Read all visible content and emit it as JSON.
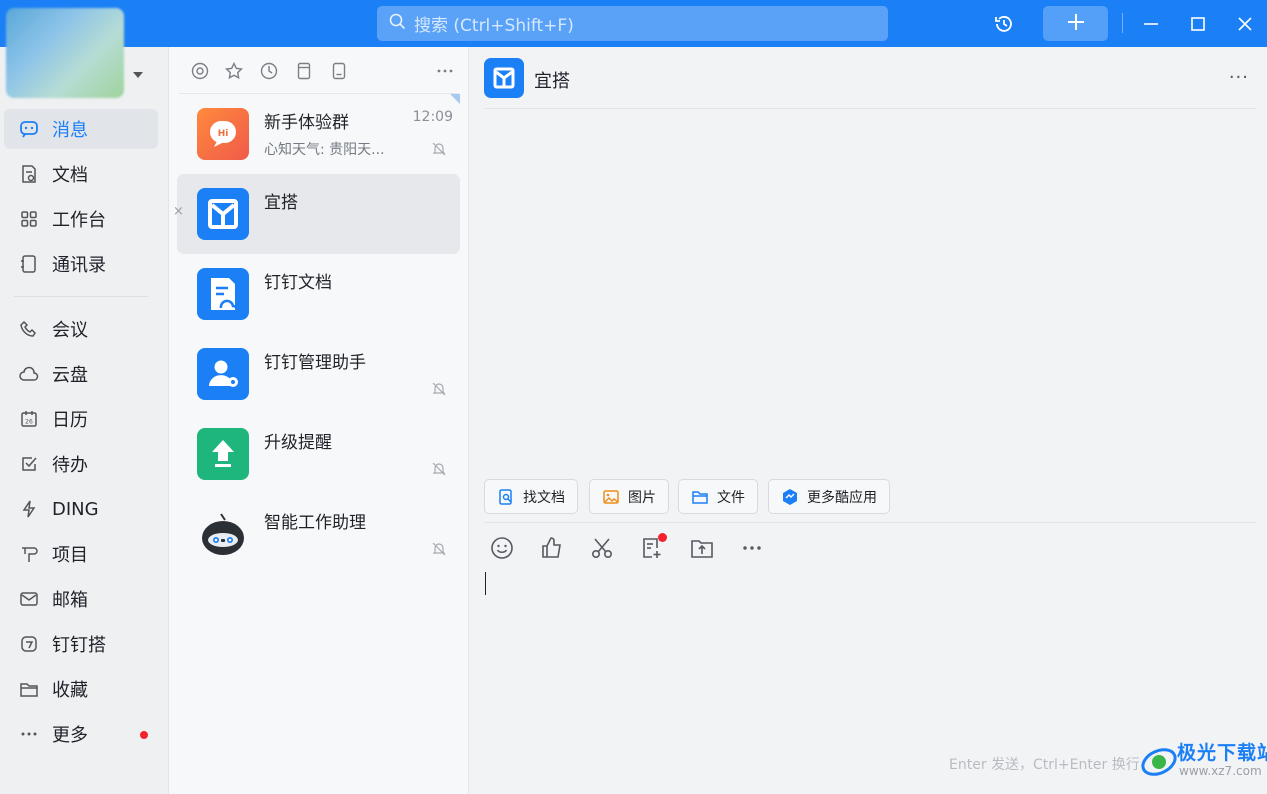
{
  "titlebar": {
    "search_placeholder": "搜索 (Ctrl+Shift+F)",
    "history_icon": "history-icon",
    "add_icon": "plus-icon",
    "window_controls": [
      "minimize-icon",
      "maximize-icon",
      "close-icon"
    ],
    "accent": "#1b7ff6"
  },
  "sidebar": {
    "items": [
      {
        "label": "消息",
        "icon": "chat-icon",
        "active": true
      },
      {
        "label": "文档",
        "icon": "document-icon"
      },
      {
        "label": "工作台",
        "icon": "apps-grid-icon"
      },
      {
        "label": "通讯录",
        "icon": "contacts-icon"
      },
      {
        "label": "会议",
        "icon": "phone-icon"
      },
      {
        "label": "云盘",
        "icon": "cloud-icon"
      },
      {
        "label": "日历",
        "icon": "calendar-icon"
      },
      {
        "label": "待办",
        "icon": "checkbox-icon"
      },
      {
        "label": "DING",
        "icon": "lightning-icon"
      },
      {
        "label": "项目",
        "icon": "project-icon"
      },
      {
        "label": "邮箱",
        "icon": "mail-icon"
      },
      {
        "label": "钉钉搭",
        "icon": "build-icon"
      },
      {
        "label": "收藏",
        "icon": "folder-icon"
      },
      {
        "label": "更多",
        "icon": "more-icon",
        "badge_dot": true
      }
    ]
  },
  "conversations": {
    "toolbar_icons": [
      "at-icon",
      "star-icon",
      "clock-icon",
      "bookmark-icon",
      "file-icon",
      "more-icon"
    ],
    "items": [
      {
        "name": "新手体验群",
        "preview": "心知天气: 贵阳天...",
        "time": "12:09",
        "muted": true
      },
      {
        "name": "宜搭",
        "preview": "",
        "time": "",
        "muted": false,
        "selected": true
      },
      {
        "name": "钉钉文档",
        "preview": "",
        "time": "",
        "muted": false
      },
      {
        "name": "钉钉管理助手",
        "preview": "",
        "time": "",
        "muted": true
      },
      {
        "name": "升级提醒",
        "preview": "",
        "time": "",
        "muted": true
      },
      {
        "name": "智能工作助理",
        "preview": "",
        "time": "",
        "muted": true
      }
    ],
    "close_glyph": "×"
  },
  "chat": {
    "title": "宜搭",
    "more": "···",
    "quick_actions": [
      {
        "label": "找文档",
        "icon": "search-doc-icon"
      },
      {
        "label": "图片",
        "icon": "image-icon"
      },
      {
        "label": "文件",
        "icon": "folder-icon"
      },
      {
        "label": "更多酷应用",
        "icon": "apps-icon"
      }
    ],
    "composer_tools": [
      "emoji-icon",
      "thumbs-up-icon",
      "scissors-icon",
      "note-add-icon",
      "upload-icon",
      "more-icon"
    ],
    "send_hint": "Enter 发送，Ctrl+Enter 换行"
  },
  "watermark": {
    "text": "极光下载站",
    "url": "www.xz7.com"
  }
}
